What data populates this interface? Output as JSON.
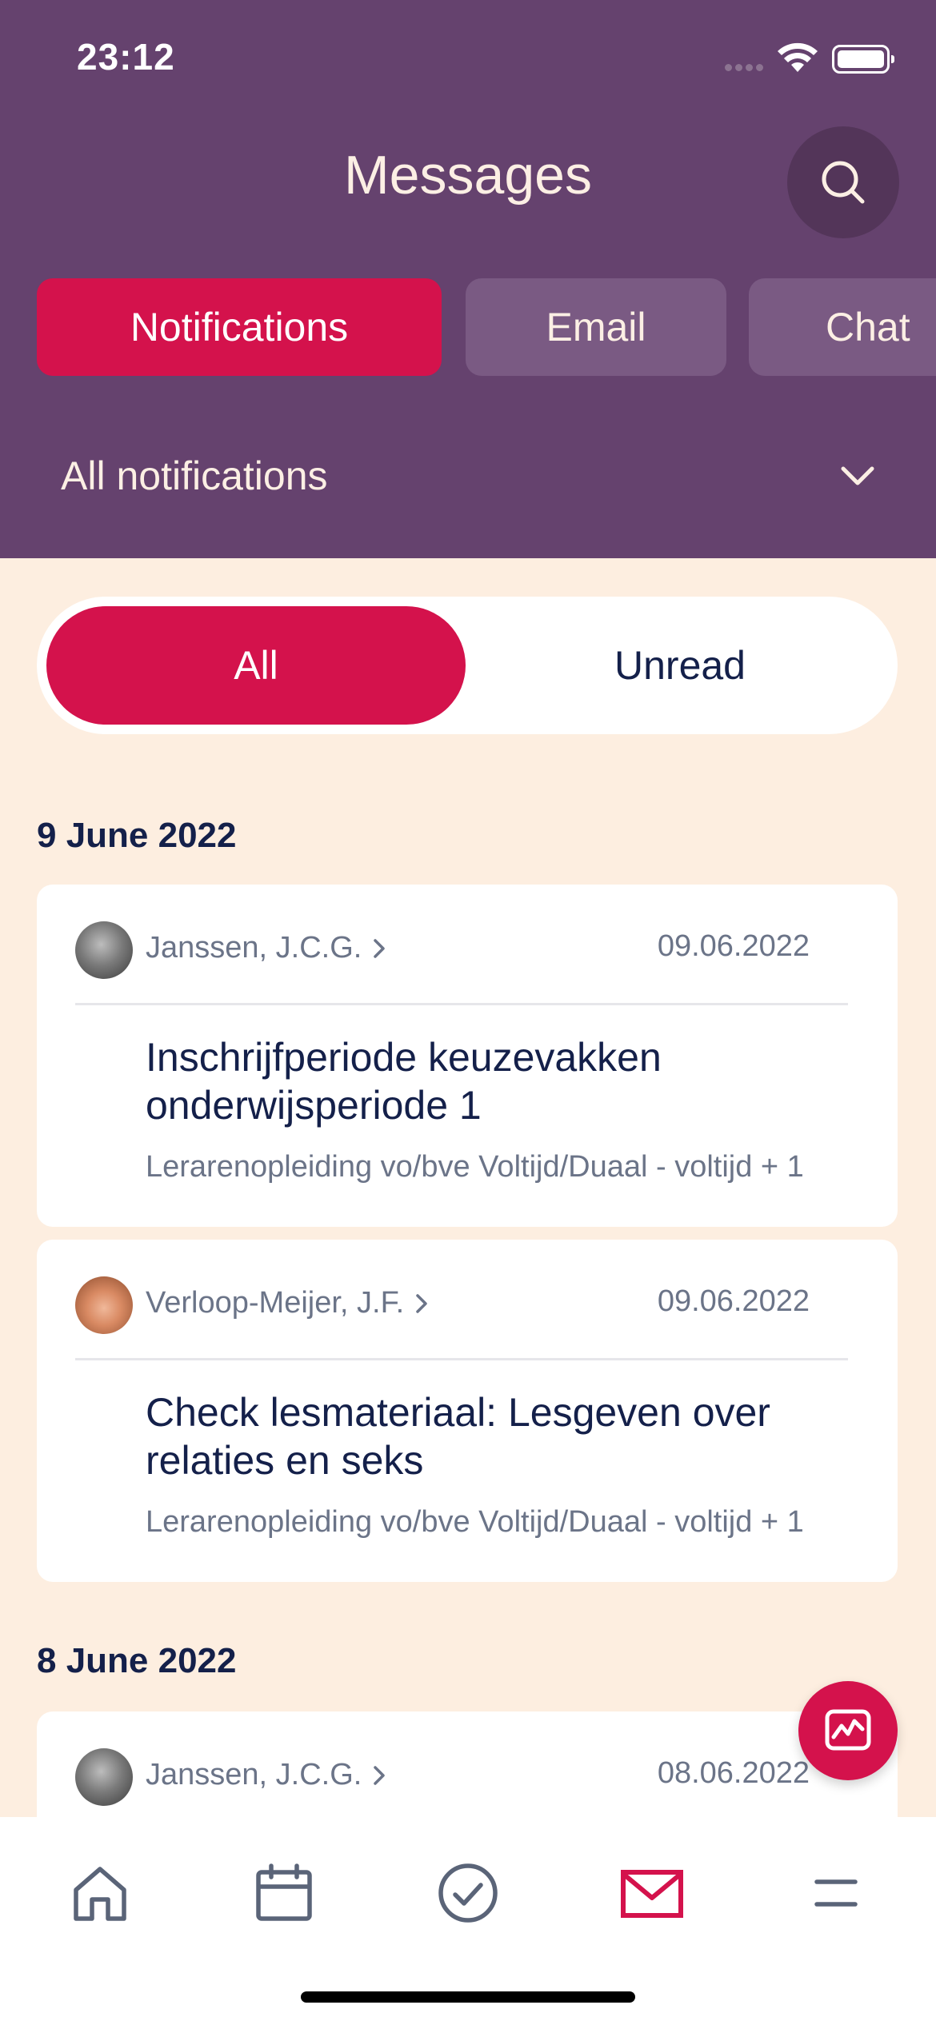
{
  "status_bar": {
    "time": "23:12"
  },
  "header": {
    "title": "Messages",
    "tabs": [
      {
        "label": "Notifications",
        "active": true
      },
      {
        "label": "Email",
        "active": false
      },
      {
        "label": "Chat",
        "active": false
      }
    ],
    "filter_label": "All notifications"
  },
  "segment": {
    "all_label": "All",
    "unread_label": "Unread",
    "selected": "All"
  },
  "groups": [
    {
      "date": "9 June 2022",
      "messages": [
        {
          "sender": "Janssen, J.C.G.",
          "date": "09.06.2022",
          "title": "Inschrijfperiode keuzevakken onderwijsperiode 1",
          "subtitle": "Lerarenopleiding vo/bve Voltijd/Duaal - voltijd + 1"
        },
        {
          "sender": "Verloop-Meijer, J.F.",
          "date": "09.06.2022",
          "title": "Check lesmateriaal: Lesgeven over relaties en seks",
          "subtitle": "Lerarenopleiding vo/bve Voltijd/Duaal - voltijd + 1"
        }
      ]
    },
    {
      "date": "8 June 2022",
      "messages": [
        {
          "sender": "Janssen, J.C.G.",
          "date": "08.06.2022"
        }
      ]
    }
  ],
  "colors": {
    "header_bg": "#65426e",
    "accent": "#d4124c",
    "page_bg": "#fdeee0",
    "text_dark": "#14204a"
  },
  "icons": {
    "search": "search-icon",
    "chevron": "chevron-down-icon",
    "fab": "activity-chart-icon",
    "nav": [
      "home-icon",
      "calendar-icon",
      "check-circle-icon",
      "mail-icon",
      "menu-icon"
    ]
  }
}
